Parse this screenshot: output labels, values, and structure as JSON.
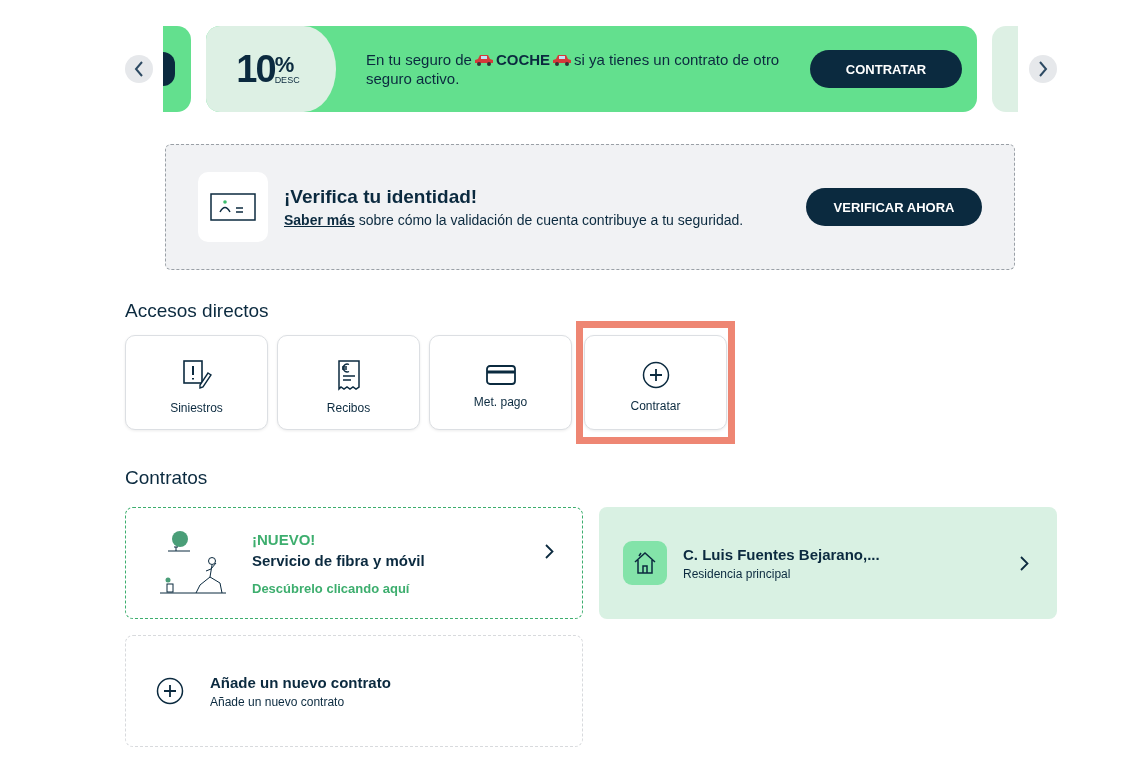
{
  "promo": {
    "percent": "10",
    "percent_sign": "%",
    "desc": "DESC",
    "text_before": "En tu seguro de",
    "product": "COCHE",
    "text_after": "si ya tienes un contrato de otro",
    "text_line2": "seguro activo.",
    "button": "CONTRATAR"
  },
  "verify": {
    "title": "¡Verifica tu identidad!",
    "link": "Saber más",
    "text": "sobre cómo la validación de cuenta contribuye a tu seguridad.",
    "button": "VERIFICAR AHORA"
  },
  "shortcuts": {
    "title": "Accesos directos",
    "items": [
      {
        "kind": "claim",
        "label": "Siniestros",
        "highlighted": false
      },
      {
        "kind": "receipt",
        "label": "Recibos",
        "highlighted": false
      },
      {
        "kind": "card",
        "label": "Met. pago",
        "highlighted": false
      },
      {
        "kind": "add",
        "label": "Contratar",
        "highlighted": true
      }
    ]
  },
  "contracts": {
    "title": "Contratos",
    "items": [
      {
        "kind": "promo",
        "badge": "¡NUEVO!",
        "title": "Servicio de fibra y móvil",
        "link": "Descúbrelo clicando aquí"
      },
      {
        "kind": "home",
        "title": "C. Luis Fuentes Bejarano,...",
        "subtitle": "Residencia principal"
      },
      {
        "kind": "add",
        "title": "Añade un nuevo contrato",
        "subtitle": "Añade un nuevo contrato"
      }
    ]
  }
}
